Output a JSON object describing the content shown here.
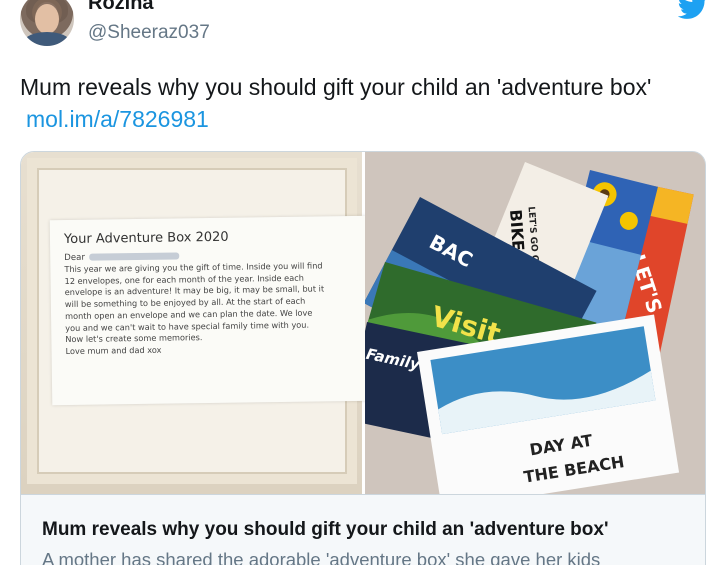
{
  "author": {
    "display_name": "Rozina",
    "handle": "@Sheeraz037",
    "avatar_icon": "profile-photo"
  },
  "twitter_icon": "twitter-bird-icon",
  "brand_color": "#1da1f2",
  "tweet": {
    "text": "Mum reveals why you should gift your child an 'adventure box'",
    "link": "mol.im/a/7826981",
    "link_color": "#1b95e0"
  },
  "card": {
    "left_photo": {
      "note_title": "Your Adventure Box 2020",
      "note_dear": "Dear",
      "note_body": "This year we are giving you the gift of time. Inside you will find\n12 envelopes, one for each month of the year. Inside each\nenvelope is an adventure! It may be big, it may be small, but it\nwill be something to be enjoyed by all. At the start of each\nmonth open an envelope and we can plan the date. We love\nyou and we can't wait to have special family time with you.\nNow let's create some memories.\nLove mum and dad xox"
    },
    "right_photo": {
      "envelope_labels": {
        "day_at": "DAY AT",
        "the_beach": "THE BEACH",
        "lets_go_on_a": "LET'S GO ON A",
        "bike_ride": "BIKE RIDE",
        "visit": "Visit",
        "family": "Family m",
        "bac": "BAC",
        "lets": "LET'S",
        "go": "GO"
      }
    },
    "title": "Mum reveals why you should gift your child an 'adventure box'",
    "description": "A mother has shared the adorable 'adventure box' she gave her kids"
  }
}
